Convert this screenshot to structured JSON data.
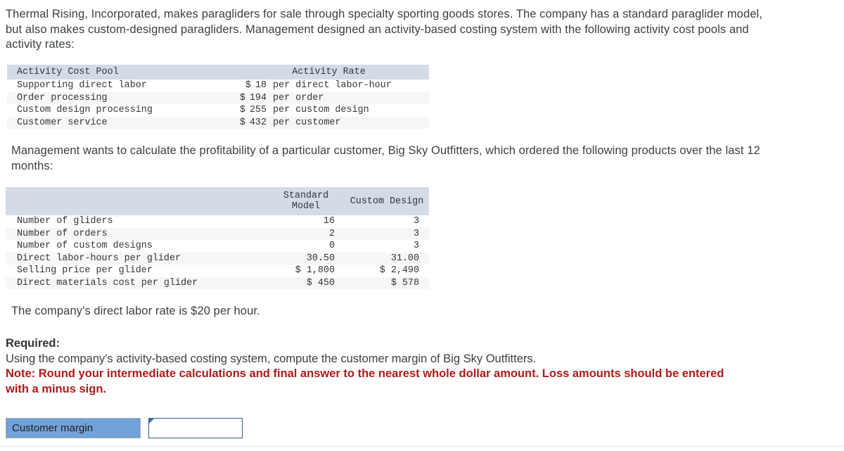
{
  "intro": {
    "paragraph": "Thermal Rising, Incorporated, makes paragliders for sale through specialty sporting goods stores. The company has a standard paraglider model, but also makes custom-designed paragliders. Management designed an activity-based costing system with the following activity cost pools and activity rates:"
  },
  "cost_pool_table": {
    "headers": {
      "pool": "Activity Cost Pool",
      "rate": "Activity Rate"
    },
    "rows": [
      {
        "pool": "Supporting direct labor",
        "symbol": "$",
        "amount": "18",
        "unit": "per direct labor-hour"
      },
      {
        "pool": "Order processing",
        "symbol": "$",
        "amount": "194",
        "unit": "per order"
      },
      {
        "pool": "Custom design processing",
        "symbol": "$",
        "amount": "255",
        "unit": "per custom design"
      },
      {
        "pool": "Customer service",
        "symbol": "$",
        "amount": "432",
        "unit": "per customer"
      }
    ]
  },
  "management": {
    "paragraph": "Management wants to calculate the profitability of a particular customer, Big Sky Outfitters, which ordered the following products over the last 12 months:"
  },
  "customer_table": {
    "headers": {
      "blank": "",
      "standard_line1": "Standard",
      "standard_line2": "Model",
      "custom": "Custom Design"
    },
    "rows": [
      {
        "label": "Number of gliders",
        "standard": "16",
        "custom": "3"
      },
      {
        "label": "Number of orders",
        "standard": "2",
        "custom": "3"
      },
      {
        "label": "Number of custom designs",
        "standard": "0",
        "custom": "3"
      },
      {
        "label": "Direct labor-hours per glider",
        "standard": "30.50",
        "custom": "31.00"
      },
      {
        "label": "Selling price per glider",
        "standard": "$ 1,800",
        "custom": "$ 2,490"
      },
      {
        "label": "Direct materials cost per glider",
        "standard": "$ 450",
        "custom": "$ 578"
      }
    ]
  },
  "labor_rate": {
    "text": "The company's direct labor rate is $20 per hour."
  },
  "required": {
    "heading": "Required:",
    "body": "Using the company's activity-based costing system, compute the customer margin of Big Sky Outfitters.",
    "note_line1": "Note: Round your intermediate calculations and final answer to the nearest whole dollar amount. Loss amounts should be entered",
    "note_line2": "with a minus sign."
  },
  "answer": {
    "label": "Customer margin",
    "value": "",
    "placeholder": ""
  },
  "colors": {
    "table_header_bg": "#d4dae6",
    "row_stripe_bg": "#f6f6f7",
    "note_red": "#ad1b1b",
    "answer_label_blue": "#71a2d9",
    "input_border_blue": "#2f5c94",
    "body_text": "#3b4045"
  }
}
